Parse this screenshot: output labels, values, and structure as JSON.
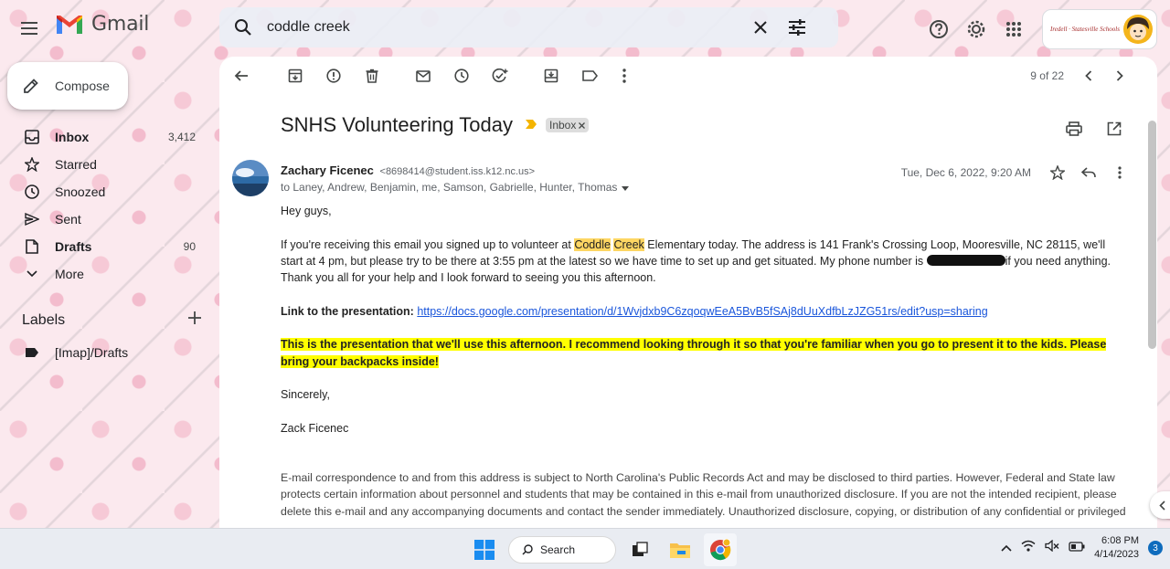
{
  "app": {
    "name": "Gmail"
  },
  "search": {
    "query": "coddle creek"
  },
  "account": {
    "org_logo_text": "Iredell · Statesville Schools"
  },
  "sidebar": {
    "compose_label": "Compose",
    "items": [
      {
        "label": "Inbox",
        "count": "3,412",
        "bold": true,
        "icon": "inbox-icon"
      },
      {
        "label": "Starred",
        "count": "",
        "bold": false,
        "icon": "star-icon"
      },
      {
        "label": "Snoozed",
        "count": "",
        "bold": false,
        "icon": "clock-icon"
      },
      {
        "label": "Sent",
        "count": "",
        "bold": false,
        "icon": "send-icon"
      },
      {
        "label": "Drafts",
        "count": "90",
        "bold": true,
        "icon": "draft-icon"
      },
      {
        "label": "More",
        "count": "",
        "bold": false,
        "icon": "chevron-down-icon"
      }
    ],
    "labels_title": "Labels",
    "labels": [
      {
        "label": "[Imap]/Drafts",
        "icon": "label-icon"
      }
    ]
  },
  "toolbar": {
    "pager": "9 of 22"
  },
  "email": {
    "subject": "SNHS Volunteering Today",
    "chip": "Inbox",
    "sender_name": "Zachary Ficenec",
    "sender_email": "<8698414@student.iss.k12.nc.us>",
    "to": "to Laney, Andrew, Benjamin, me, Samson, Gabrielle, Hunter, Thomas",
    "date": "Tue, Dec 6, 2022, 9:20 AM",
    "greeting": "Hey guys,",
    "p1_a": "If you're receiving this email you signed up to volunteer at ",
    "p1_hl1": "Coddle",
    "p1_hl2": "Creek",
    "p1_b": " Elementary today. The address is 141 Frank's Crossing Loop, Mooresville, NC 28115, we'll start at 4 pm, but please try to be there at 3:55 pm at the latest so we have time to set up and get situated. My phone number is ",
    "p1_c": "if you need anything. Thank you all for your help and I look forward to seeing you this afternoon.",
    "link_label": "Link to the presentation:",
    "link_url": "https://docs.google.com/presentation/d/1Wvjdxb9C6zqoqwEeA5BvB5fSAj8dUuXdfbLzJZG51rs/edit?usp=sharing",
    "highlight_text": "This is the presentation that we'll use this afternoon. I recommend looking through it so that you're familiar when you go to present it to the kids. Please bring your backpacks inside!",
    "closing": "Sincerely,",
    "signature": "Zack Ficenec",
    "disclaimer": "E-mail correspondence to and from this address is subject to North Carolina's Public Records Act and may be disclosed to third parties. However, Federal and State law protects certain information about personnel and students that may be contained in this e-mail from unauthorized disclosure. If you are not the intended recipient, please delete this e-mail and any accompanying documents and contact the sender immediately. Unauthorized disclosure, copying, or distribution of any confidential or privileged"
  },
  "taskbar": {
    "search_label": "Search",
    "time": "6:08 PM",
    "date": "4/14/2023",
    "notifications": "3"
  },
  "colors": {
    "accent": "#1a56db",
    "highlight": "#ffff00",
    "search_hl": "#fdd663",
    "importance": "#f4b400"
  }
}
